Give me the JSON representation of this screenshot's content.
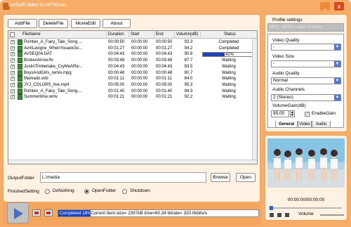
{
  "app": {
    "title": "bvcSoft Video to MP3Gain",
    "minimize_label": "_",
    "close_label": "x"
  },
  "toolbar": {
    "add_file": "AddFile",
    "delete_file": "DeleteFile",
    "movie_edit": "MovieEdit",
    "about": "About"
  },
  "grid": {
    "headers": [
      "FileName",
      "Duration",
      "Start",
      "End",
      "Volumn(dB)",
      "Status"
    ],
    "rows": [
      {
        "file": "Pointen_A_Fairy_Tale_Song....",
        "duration": "00:00:50",
        "start": "00:00:00",
        "end": "00:00:50",
        "vol": "93.3",
        "status": "Completed",
        "checked": true
      },
      {
        "file": "AvrilLavigne_WhenYouareGo...",
        "duration": "00:01:27",
        "start": "00:00:00",
        "end": "00:01:27",
        "vol": "94.2",
        "status": "Completed",
        "checked": true
      },
      {
        "file": "AVSEQ04.DAT",
        "duration": "00:04:43",
        "start": "00:00:00",
        "end": "00:04:43",
        "vol": "90.8",
        "status": "42%",
        "progress": 0.42,
        "checked": true
      },
      {
        "file": "BrokenArrow.flv",
        "duration": "00:03:48",
        "start": "00:00:00",
        "end": "00:03:48",
        "vol": "87.7",
        "status": "Waiting",
        "checked": true
      },
      {
        "file": "JustinTimberlake_CryMeARiv...",
        "duration": "00:04:43",
        "start": "00:00:00",
        "end": "00:04:43",
        "vol": "83.5",
        "status": "Waiting",
        "checked": true
      },
      {
        "file": "BoysAndGirls_remix.mpg",
        "duration": "00:00:48",
        "start": "00:00:00",
        "end": "00:00:48",
        "vol": "80.7",
        "status": "Waiting",
        "checked": true
      },
      {
        "file": "Mamado.vob",
        "duration": "00:01:11",
        "start": "00:00:00",
        "end": "00:01:11",
        "vol": "84.0",
        "status": "Waiting",
        "checked": true
      },
      {
        "file": "JYJ_COLORS_live.mp4",
        "duration": "00:05:00",
        "start": "00:00:00",
        "end": "00:05:00",
        "vol": "95.3",
        "status": "Waiting",
        "checked": true
      },
      {
        "file": "Pointen_A_Fairy_Tale_Song....",
        "duration": "00:01:40",
        "start": "00:00:00",
        "end": "00:01:40",
        "vol": "94.3",
        "status": "Waiting",
        "checked": true
      },
      {
        "file": "Summertime.wmv",
        "duration": "00:01:21",
        "start": "00:00:00",
        "end": "00:01:21",
        "vol": "92.2",
        "status": "Waiting",
        "checked": true
      }
    ]
  },
  "output": {
    "label": "OutputFolder",
    "value": "L:\\media",
    "browse": "Browse",
    "open": "Open"
  },
  "finished": {
    "label": "FinishedSetting",
    "options": [
      "DoNothing",
      "OpenFolder",
      "Shutdown"
    ],
    "selected": "OpenFolder"
  },
  "profile": {
    "label": "Profile settings",
    "value": "MP3 - MPEG Layer-3 Audio"
  },
  "settings": {
    "video_quality_label": "Video Quality",
    "video_quality_value": "-",
    "video_size_label": "Video Size",
    "video_size_value": "-",
    "audio_quality_label": "Audio Quality",
    "audio_quality_value": "Normal",
    "audio_channels_label": "Audio Channels",
    "audio_channels_value": "2 (Stereo)",
    "volume_gain_label": "VolumeGain(dB)",
    "volume_gain_value": "95.00",
    "enable_gain_label": "EnableGain",
    "enable_gain_checked": true,
    "tabs": [
      "General",
      "Video",
      "Audio"
    ],
    "active_tab": "General"
  },
  "player": {
    "time": "00:00:00/00:00:00",
    "volume_label": "Volume",
    "position": 0.02
  },
  "status": {
    "completed": "Completed 16%",
    "current_item": "Current Item:size=   2357kB time=60.34 bitrate= 320.0kbits/s",
    "progress": 0.16
  },
  "colors": {
    "accent": "#1c44be",
    "window": "#f7ad68",
    "panel": "#fff2e2"
  }
}
